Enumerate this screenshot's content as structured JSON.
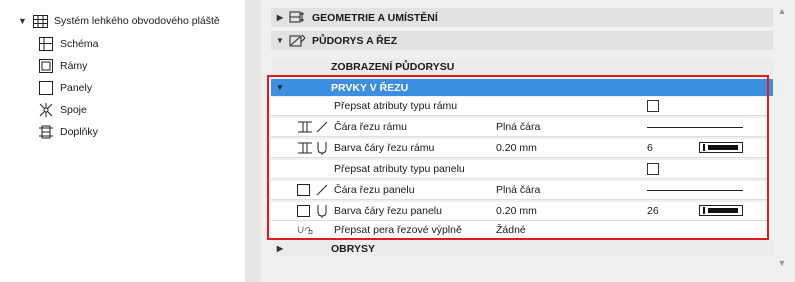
{
  "tree": {
    "root_label": "Systém lehkého obvodového pláště",
    "items": [
      {
        "label": "Schéma",
        "icon": "schema-icon"
      },
      {
        "label": "Rámy",
        "icon": "frames-icon"
      },
      {
        "label": "Panely",
        "icon": "panels-icon"
      },
      {
        "label": "Spoje",
        "icon": "junctions-icon"
      },
      {
        "label": "Doplňky",
        "icon": "accessories-icon"
      }
    ]
  },
  "panel": {
    "sections": [
      {
        "label": "GEOMETRIE A UMÍSTĚNÍ",
        "icon": "geometry-icon"
      },
      {
        "label": "PŮDORYS A ŘEZ",
        "icon": "floorplan-section-icon"
      }
    ],
    "subsections": {
      "floorplan_display": "ZOBRAZENÍ PŮDORYSU",
      "cut_elements": "PRVKY V ŘEZU",
      "outlines": "OBRYSY"
    },
    "rows": {
      "override_frame": "Přepsat atributy typu rámu",
      "frame_cut_line": {
        "label": "Čára řezu rámu",
        "value": "Plná čára"
      },
      "frame_cut_pen": {
        "label": "Barva čáry řezu rámu",
        "value": "0.20 mm",
        "pen": "6"
      },
      "override_panel": "Přepsat atributy typu panelu",
      "panel_cut_line": {
        "label": "Čára řezu panelu",
        "value": "Plná čára"
      },
      "panel_cut_pen": {
        "label": "Barva čáry řezu panelu",
        "value": "0.20 mm",
        "pen": "26"
      },
      "override_fill_pens": {
        "label": "Přepsat pera řezové výplně",
        "value": "Žádné"
      }
    }
  },
  "colors": {
    "selected_row": "#3c8fe0",
    "highlight_border": "#e01b1b"
  }
}
